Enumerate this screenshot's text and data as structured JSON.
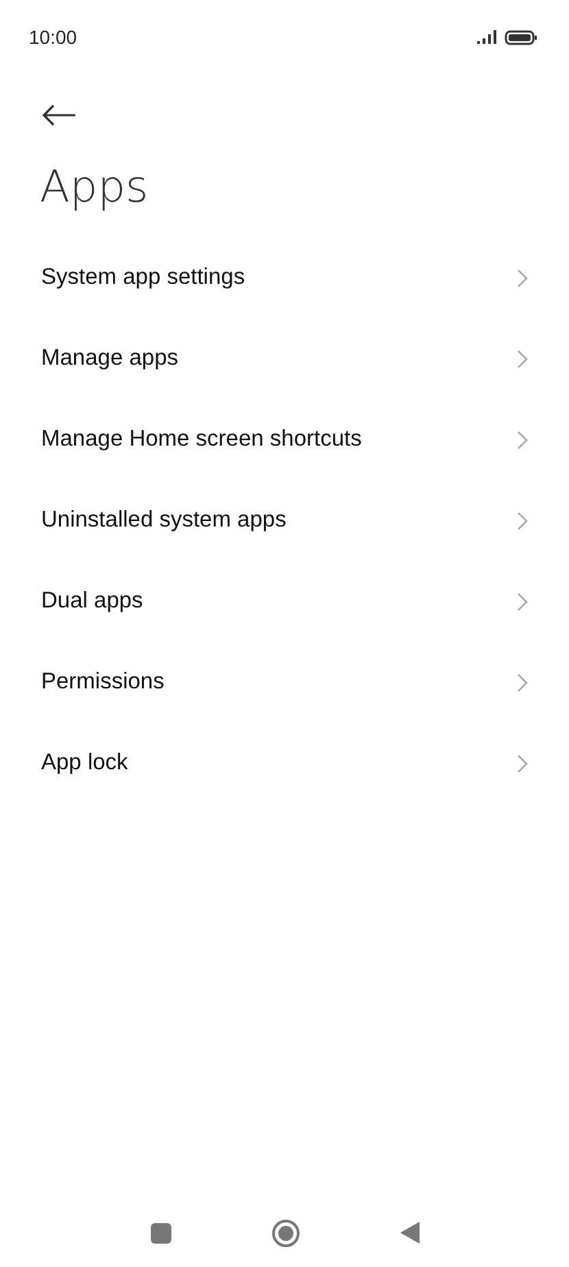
{
  "status_bar": {
    "time": "10:00"
  },
  "title": "Apps",
  "items": [
    {
      "label": "System app settings"
    },
    {
      "label": "Manage apps"
    },
    {
      "label": "Manage Home screen shortcuts"
    },
    {
      "label": "Uninstalled system apps"
    },
    {
      "label": "Dual apps"
    },
    {
      "label": "Permissions"
    },
    {
      "label": "App lock"
    }
  ]
}
